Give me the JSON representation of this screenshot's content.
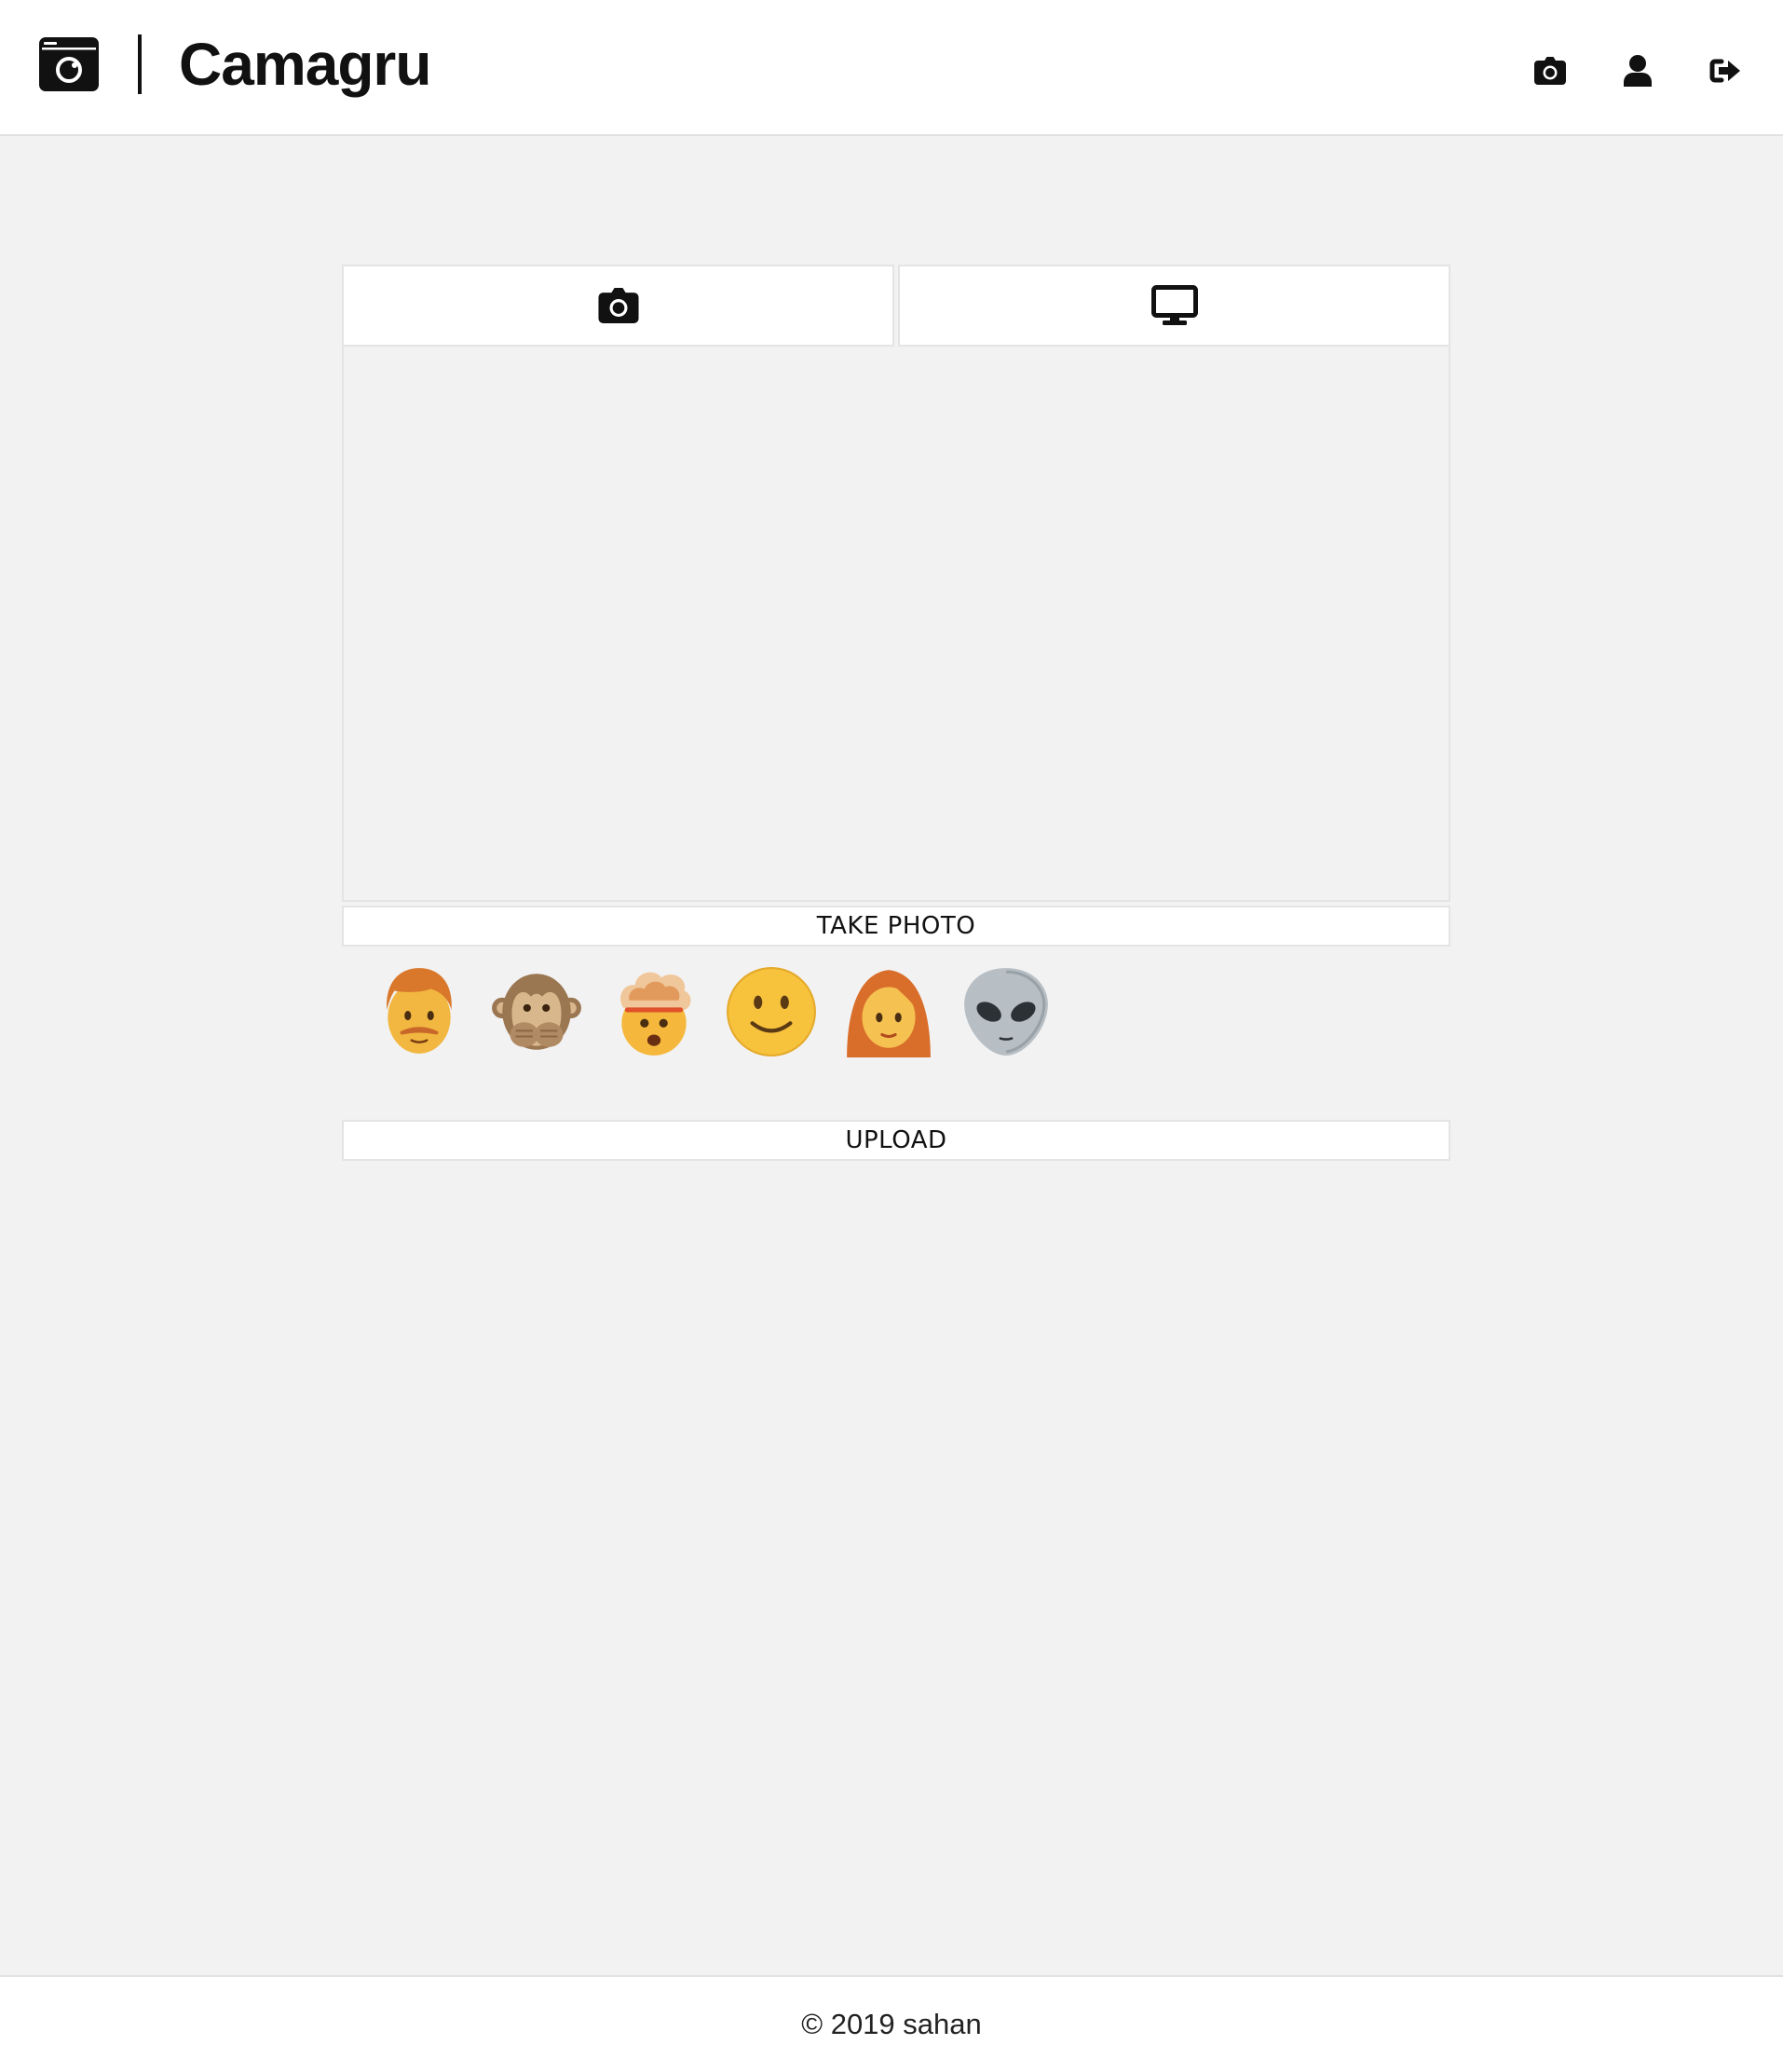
{
  "app": {
    "title": "Camagru",
    "logo_icon": "camera-frame-logo-icon"
  },
  "nav": {
    "items": [
      {
        "icon": "camera-icon"
      },
      {
        "icon": "user-icon"
      },
      {
        "icon": "sign-out-icon"
      }
    ]
  },
  "capture": {
    "tabs": [
      {
        "icon": "camera-icon"
      },
      {
        "icon": "desktop-icon"
      }
    ],
    "take_photo_label": "TAKE PHOTO",
    "upload_label": "UPLOAD",
    "stickers": [
      {
        "icon": "man-emoji"
      },
      {
        "icon": "speak-no-evil-monkey-emoji"
      },
      {
        "icon": "exploding-head-emoji"
      },
      {
        "icon": "slightly-smiling-face-emoji"
      },
      {
        "icon": "woman-emoji"
      },
      {
        "icon": "alien-emoji"
      }
    ]
  },
  "footer": {
    "text": "© 2019 sahan"
  },
  "colors": {
    "page_background": "#f2f2f2",
    "surface": "#ffffff",
    "border": "#e4e4e4",
    "text": "#111111"
  }
}
